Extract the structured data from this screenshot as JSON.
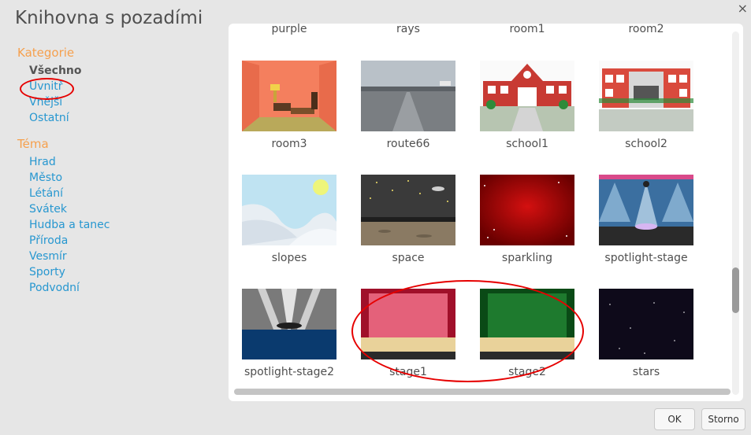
{
  "dialog": {
    "title": "Knihovna s pozadími",
    "close_symbol": "×"
  },
  "sidebar": {
    "category_heading": "Kategorie",
    "categories": [
      "Všechno",
      "Uvnitř",
      "Vnější",
      "Ostatní"
    ],
    "active_category": "Všechno",
    "theme_heading": "Téma",
    "themes": [
      "Hrad",
      "Město",
      "Létání",
      "Svátek",
      "Hudba a tanec",
      "Příroda",
      "Vesmír",
      "Sporty",
      "Podvodní"
    ]
  },
  "library": {
    "partial_top_row": [
      "purple",
      "rays",
      "room1",
      "room2"
    ],
    "rows": [
      [
        "room3",
        "route66",
        "school1",
        "school2"
      ],
      [
        "slopes",
        "space",
        "sparkling",
        "spotlight-stage"
      ],
      [
        "spotlight-stage2",
        "stage1",
        "stage2",
        "stars"
      ]
    ]
  },
  "buttons": {
    "ok": "OK",
    "cancel": "Storno"
  },
  "colors": {
    "background": "#e6e6e6",
    "heading_orange": "#f6a04d",
    "link_blue": "#2797d0",
    "annotation_red": "#e60000"
  }
}
